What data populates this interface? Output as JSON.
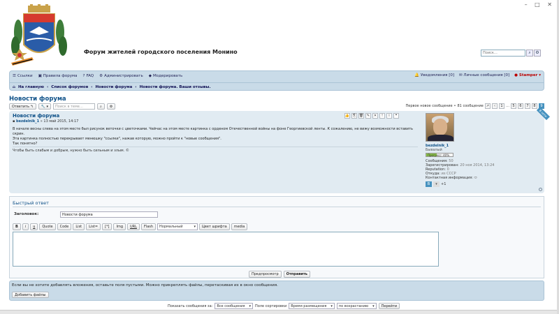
{
  "window": {
    "controls": "– □ ✕"
  },
  "header": {
    "site_title": "Форум жителей городского поселения Монино",
    "search_placeholder": "Поиск…"
  },
  "nav": {
    "items": [
      "Ссылки",
      "Правила форума",
      "FAQ",
      "Администрировать",
      "Модерировать"
    ],
    "notifications": "Уведомления [0]",
    "private_messages": "Личные сообщения [0]",
    "username": "Stamper"
  },
  "breadcrumbs": [
    "На главную",
    "Список форумов",
    "Новости форума",
    "Новости форума. Ваши отзывы."
  ],
  "topic": {
    "title": "Новости форума",
    "reply_button": "Ответить",
    "search_placeholder": "Поиск в теме…",
    "first_unread": "Первое новое сообщение",
    "message_count": "81 сообщение",
    "pages": [
      "1",
      "…",
      "5",
      "6",
      "7",
      "8",
      "9"
    ],
    "current_page": "9"
  },
  "post": {
    "title": "Новости форума",
    "author": "bezdelnik_1",
    "date": "» 13 май 2015, 14:17",
    "body": [
      "В начале весны слева на этом месте был рисунок веточки с цветочками. Чейчас на этом месте картинка с орденом Отечественной войны на фоне Георгиевской ленты. К сожалению, не вижу возможности вставить скрин.",
      "Эта картинка полностью перекрывает менюшку \"ссылки\", нажав которую, можно пройти к \"новые сообщения\".",
      "Так понятно?"
    ],
    "signature": "Чтобы быть слабым и добрым, нужно быть сильным и злым. ©",
    "online_badge": "В сети"
  },
  "profile": {
    "name": "bezdelnik_1",
    "rank": "Бывалый",
    "progress_label": "Прогресс: 40%",
    "progress_value": 0.4,
    "rows": [
      {
        "k": "Сообщения:",
        "v": "50"
      },
      {
        "k": "Зарегистрирован:",
        "v": "20 ноя 2014, 13:24"
      },
      {
        "k": "Reputation:",
        "v": "0"
      },
      {
        "k": "Откуда:",
        "v": "из СССР"
      },
      {
        "k": "Контактная информация:",
        "v": ""
      }
    ],
    "vote_plus": "+1"
  },
  "quick_reply": {
    "title": "Быстрый ответ",
    "subject_label": "Заголовок:",
    "subject_value": "Новости форума",
    "format_buttons": [
      "B",
      "i",
      "u",
      "Quote",
      "Code",
      "List",
      "List=",
      "[*]",
      "Img",
      "URL",
      "Flash"
    ],
    "size_select": "Нормальный",
    "color_button": "Цвет шрифта",
    "media_button": "media",
    "preview_button": "Предпросмотр",
    "submit_button": "Отправить"
  },
  "attachments": {
    "text": "Если вы не хотите добавлять вложения, оставьте поля пустыми. Можно прикреплять файлы, перетаскивая их в окно сообщения.",
    "add_button": "Добавить файлы"
  },
  "sort": {
    "show_label": "Показать сообщения за:",
    "show_value": "Все сообщения",
    "sort_label": "Поле сортировки",
    "sort_value": "Время размещения",
    "order_value": "по возрастанию",
    "go_button": "Перейти"
  }
}
